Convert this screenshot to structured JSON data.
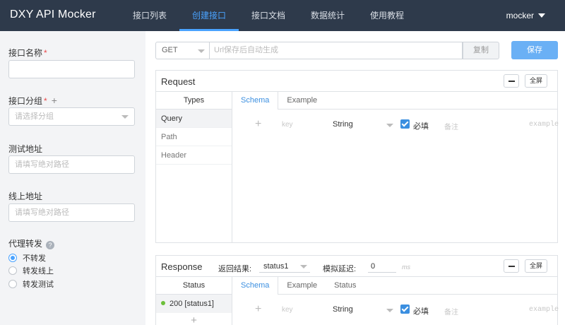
{
  "app": {
    "brand": "DXY API Mocker",
    "user": "mocker"
  },
  "nav": [
    {
      "label": "接口列表",
      "active": false
    },
    {
      "label": "创建接口",
      "active": true
    },
    {
      "label": "接口文档",
      "active": false
    },
    {
      "label": "数据统计",
      "active": false
    },
    {
      "label": "使用教程",
      "active": false
    }
  ],
  "form": {
    "name_label": "接口名称",
    "name_value": "",
    "group_label": "接口分组",
    "group_placeholder": "请选择分组",
    "test_url_label": "测试地址",
    "test_url_placeholder": "请填写绝对路径",
    "online_url_label": "线上地址",
    "online_url_placeholder": "请填写绝对路径",
    "proxy_label": "代理转发",
    "help_glyph": "?",
    "proxy_options": [
      "不转发",
      "转发线上",
      "转发测试"
    ],
    "proxy_selected": "不转发",
    "required_mark": "*"
  },
  "toolbar": {
    "method": "GET",
    "url_placeholder": "Url保存后自动生成",
    "copy_label": "复制",
    "save_label": "保存"
  },
  "request": {
    "title": "Request",
    "full_label": "全屏",
    "types_header": "Types",
    "types": [
      "Query",
      "Path",
      "Header"
    ],
    "selected_type": "Query",
    "tabs": [
      "Schema",
      "Example"
    ],
    "active_tab": "Schema",
    "row": {
      "key_placeholder": "key",
      "type": "String",
      "required_label": "必填",
      "remark_placeholder": "备注",
      "example_placeholder": "example"
    }
  },
  "response": {
    "title": "Response",
    "full_label": "全屏",
    "result_label": "返回结果:",
    "result_value": "status1",
    "delay_label": "模拟延迟:",
    "delay_value": "0",
    "delay_unit": "ms",
    "status_header": "Status",
    "statuses": [
      {
        "label": "200 [status1]",
        "color": "#6cbf3a"
      }
    ],
    "tabs": [
      "Schema",
      "Example",
      "Status"
    ],
    "active_tab": "Schema",
    "row": {
      "key_placeholder": "key",
      "type": "String",
      "required_label": "必填",
      "remark_placeholder": "备注",
      "example_placeholder": "example"
    }
  },
  "colors": {
    "nav_bg": "#2e3a4b",
    "accent": "#4aa3ff",
    "save_bg": "#6ab0f5",
    "required": "#e94b4b"
  }
}
